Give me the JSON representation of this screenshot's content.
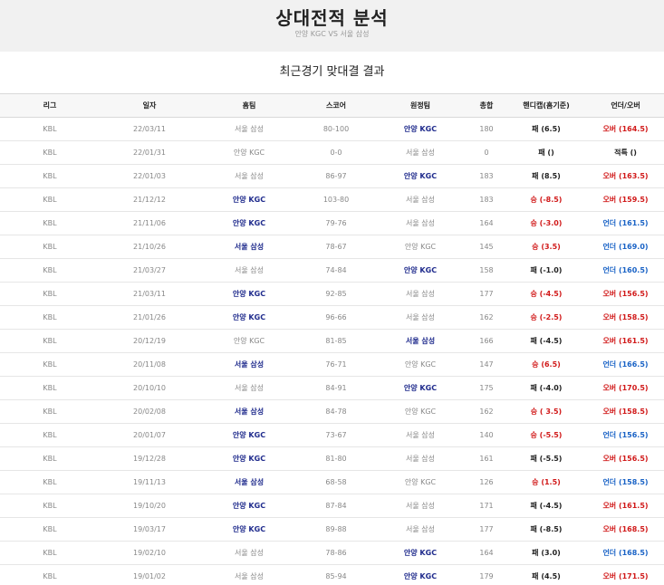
{
  "header": {
    "title": "상대전적 분석",
    "subtitle": "안양 KGC VS 서울 삼성"
  },
  "section_title": "최근경기 맞대결 결과",
  "columns": [
    "리그",
    "일자",
    "홈팀",
    "스코어",
    "원정팀",
    "총합",
    "핸디캡(홈기준)",
    "언더/오버"
  ],
  "colors": {
    "win_team": "#1e2a8c",
    "red": "#d11a1a",
    "blue": "#1a63c6"
  },
  "rows": [
    {
      "league": "KBL",
      "date": "22/03/11",
      "home": "서울 삼성",
      "score": "80-100",
      "away": "안양 KGC",
      "total": "180",
      "handicap": "패 (6.5)",
      "ou": "오버 (164.5)",
      "winner": "away",
      "hc_color": "black",
      "ou_color": "red"
    },
    {
      "league": "KBL",
      "date": "22/01/31",
      "home": "안양 KGC",
      "score": "0-0",
      "away": "서울 삼성",
      "total": "0",
      "handicap": "패 ()",
      "ou": "적특 ()",
      "winner": "none",
      "hc_color": "black",
      "ou_color": "black"
    },
    {
      "league": "KBL",
      "date": "22/01/03",
      "home": "서울 삼성",
      "score": "86-97",
      "away": "안양 KGC",
      "total": "183",
      "handicap": "패 (8.5)",
      "ou": "오버 (163.5)",
      "winner": "away",
      "hc_color": "black",
      "ou_color": "red"
    },
    {
      "league": "KBL",
      "date": "21/12/12",
      "home": "안양 KGC",
      "score": "103-80",
      "away": "서울 삼성",
      "total": "183",
      "handicap": "승 (-8.5)",
      "ou": "오버 (159.5)",
      "winner": "home",
      "hc_color": "red",
      "ou_color": "red"
    },
    {
      "league": "KBL",
      "date": "21/11/06",
      "home": "안양 KGC",
      "score": "79-76",
      "away": "서울 삼성",
      "total": "164",
      "handicap": "승 (-3.0)",
      "ou": "언더 (161.5)",
      "winner": "home",
      "hc_color": "red",
      "ou_color": "blue"
    },
    {
      "league": "KBL",
      "date": "21/10/26",
      "home": "서울 삼성",
      "score": "78-67",
      "away": "안양 KGC",
      "total": "145",
      "handicap": "승 (3.5)",
      "ou": "언더 (169.0)",
      "winner": "home",
      "hc_color": "red",
      "ou_color": "blue"
    },
    {
      "league": "KBL",
      "date": "21/03/27",
      "home": "서울 삼성",
      "score": "74-84",
      "away": "안양 KGC",
      "total": "158",
      "handicap": "패 (-1.0)",
      "ou": "언더 (160.5)",
      "winner": "away",
      "hc_color": "black",
      "ou_color": "blue"
    },
    {
      "league": "KBL",
      "date": "21/03/11",
      "home": "안양 KGC",
      "score": "92-85",
      "away": "서울 삼성",
      "total": "177",
      "handicap": "승 (-4.5)",
      "ou": "오버 (156.5)",
      "winner": "home",
      "hc_color": "red",
      "ou_color": "red"
    },
    {
      "league": "KBL",
      "date": "21/01/26",
      "home": "안양 KGC",
      "score": "96-66",
      "away": "서울 삼성",
      "total": "162",
      "handicap": "승 (-2.5)",
      "ou": "오버 (158.5)",
      "winner": "home",
      "hc_color": "red",
      "ou_color": "red"
    },
    {
      "league": "KBL",
      "date": "20/12/19",
      "home": "안양 KGC",
      "score": "81-85",
      "away": "서울 삼성",
      "total": "166",
      "handicap": "패 (-4.5)",
      "ou": "오버 (161.5)",
      "winner": "away",
      "hc_color": "black",
      "ou_color": "red"
    },
    {
      "league": "KBL",
      "date": "20/11/08",
      "home": "서울 삼성",
      "score": "76-71",
      "away": "안양 KGC",
      "total": "147",
      "handicap": "승 (6.5)",
      "ou": "언더 (166.5)",
      "winner": "home",
      "hc_color": "red",
      "ou_color": "blue"
    },
    {
      "league": "KBL",
      "date": "20/10/10",
      "home": "서울 삼성",
      "score": "84-91",
      "away": "안양 KGC",
      "total": "175",
      "handicap": "패 (-4.0)",
      "ou": "오버 (170.5)",
      "winner": "away",
      "hc_color": "black",
      "ou_color": "red"
    },
    {
      "league": "KBL",
      "date": "20/02/08",
      "home": "서울 삼성",
      "score": "84-78",
      "away": "안양 KGC",
      "total": "162",
      "handicap": "승 ( 3.5)",
      "ou": "오버 (158.5)",
      "winner": "home",
      "hc_color": "red",
      "ou_color": "red"
    },
    {
      "league": "KBL",
      "date": "20/01/07",
      "home": "안양 KGC",
      "score": "73-67",
      "away": "서울 삼성",
      "total": "140",
      "handicap": "승 (-5.5)",
      "ou": "언더 (156.5)",
      "winner": "home",
      "hc_color": "red",
      "ou_color": "blue"
    },
    {
      "league": "KBL",
      "date": "19/12/28",
      "home": "안양 KGC",
      "score": "81-80",
      "away": "서울 삼성",
      "total": "161",
      "handicap": "패 (-5.5)",
      "ou": "오버 (156.5)",
      "winner": "home",
      "hc_color": "black",
      "ou_color": "red"
    },
    {
      "league": "KBL",
      "date": "19/11/13",
      "home": "서울 삼성",
      "score": "68-58",
      "away": "안양 KGC",
      "total": "126",
      "handicap": "승 (1.5)",
      "ou": "언더 (158.5)",
      "winner": "home",
      "hc_color": "red",
      "ou_color": "blue"
    },
    {
      "league": "KBL",
      "date": "19/10/20",
      "home": "안양 KGC",
      "score": "87-84",
      "away": "서울 삼성",
      "total": "171",
      "handicap": "패 (-4.5)",
      "ou": "오버 (161.5)",
      "winner": "home",
      "hc_color": "black",
      "ou_color": "red"
    },
    {
      "league": "KBL",
      "date": "19/03/17",
      "home": "안양 KGC",
      "score": "89-88",
      "away": "서울 삼성",
      "total": "177",
      "handicap": "패 (-8.5)",
      "ou": "오버 (168.5)",
      "winner": "home",
      "hc_color": "black",
      "ou_color": "red"
    },
    {
      "league": "KBL",
      "date": "19/02/10",
      "home": "서울 삼성",
      "score": "78-86",
      "away": "안양 KGC",
      "total": "164",
      "handicap": "패 (3.0)",
      "ou": "언더 (168.5)",
      "winner": "away",
      "hc_color": "black",
      "ou_color": "blue"
    },
    {
      "league": "KBL",
      "date": "19/01/02",
      "home": "서울 삼성",
      "score": "85-94",
      "away": "안양 KGC",
      "total": "179",
      "handicap": "패 (4.5)",
      "ou": "오버 (171.5)",
      "winner": "away",
      "hc_color": "black",
      "ou_color": "red"
    }
  ]
}
